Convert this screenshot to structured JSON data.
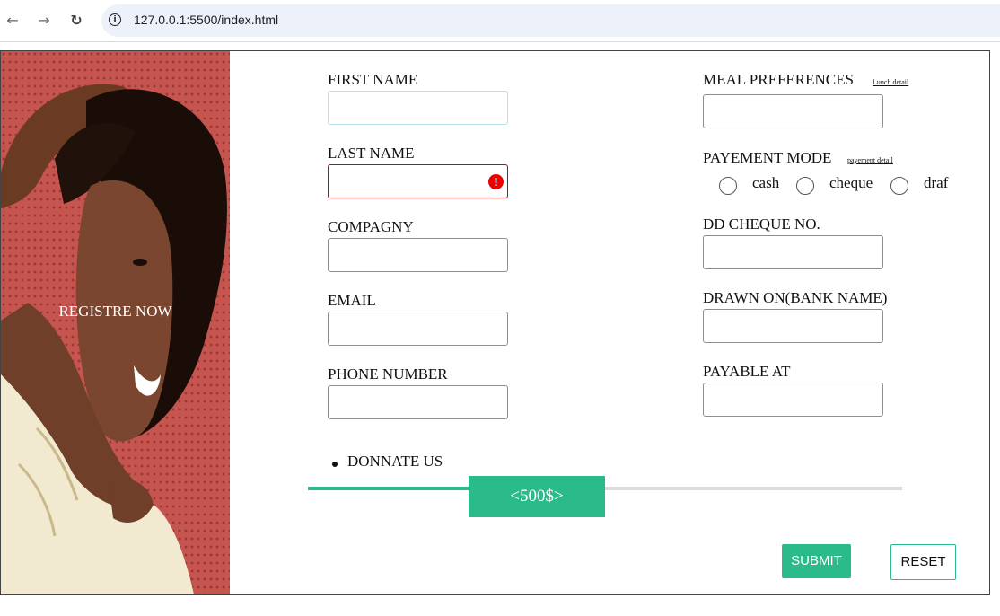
{
  "browser": {
    "url": "127.0.0.1:5500/index.html",
    "back_icon": "back-arrow-icon",
    "forward_icon": "forward-arrow-icon",
    "reload_icon": "reload-icon",
    "info_icon": "info-icon",
    "info_glyph": "i",
    "back_glyph": "←",
    "forward_glyph": "→",
    "reload_glyph": "↻"
  },
  "hero": {
    "text": "REGISTRE NOW"
  },
  "form_left": {
    "first_name_label": "FIRST NAME",
    "last_name_label": "LAST NAME",
    "last_name_error_glyph": "!",
    "company_label": "COMPAGNY",
    "email_label": "EMAIL",
    "phone_label": "PHONE NUMBER"
  },
  "form_right": {
    "meal_label": "MEAL PREFERENCES",
    "meal_link": "Lunch detail",
    "payment_label": "PAYEMENT MODE",
    "payment_link": "payement detail",
    "payment_options": [
      "cash",
      "cheque",
      "draf"
    ],
    "dd_cheque_label": "DD CHEQUE NO.",
    "drawn_on_label": "DRAWN ON(BANK NAME)",
    "payable_at_label": "PAYABLE AT"
  },
  "donate": {
    "label": "DONNATE US",
    "value_label": "<500$>",
    "slider_fraction": 0.27
  },
  "buttons": {
    "submit": "SUBMIT",
    "reset": "RESET"
  },
  "colors": {
    "accent": "#2bba8a",
    "error": "#e00000",
    "hero_bg": "#c7554f"
  }
}
